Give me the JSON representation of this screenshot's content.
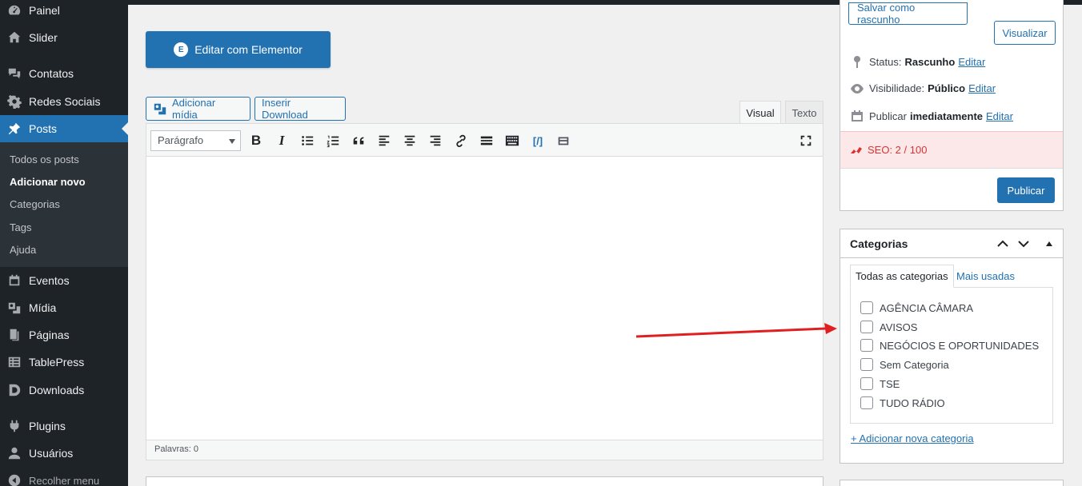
{
  "sidebar": {
    "items": [
      {
        "label": "Painel",
        "icon": "dashboard-icon"
      },
      {
        "label": "Slider",
        "icon": "home-icon"
      },
      {
        "label": "Contatos",
        "icon": "comments-icon"
      },
      {
        "label": "Redes Sociais",
        "icon": "gear-icon"
      },
      {
        "label": "Posts",
        "icon": "pin-icon"
      },
      {
        "label": "Eventos",
        "icon": "calendar-icon"
      },
      {
        "label": "Mídia",
        "icon": "media-icon"
      },
      {
        "label": "Páginas",
        "icon": "pages-icon"
      },
      {
        "label": "TablePress",
        "icon": "table-icon"
      },
      {
        "label": "Downloads",
        "icon": "download-d-icon"
      },
      {
        "label": "Plugins",
        "icon": "plugin-icon"
      },
      {
        "label": "Usuários",
        "icon": "user-icon"
      },
      {
        "label": "Recolher menu",
        "icon": "collapse-icon"
      }
    ],
    "submenu": [
      "Todos os posts",
      "Adicionar novo",
      "Categorias",
      "Tags",
      "Ajuda"
    ]
  },
  "editor": {
    "elementor_label": "Editar com Elementor",
    "add_media_label": "Adicionar mídia",
    "insert_download_label": "Inserir Download",
    "tabs": [
      "Visual",
      "Texto"
    ],
    "format_select": "Parágrafo",
    "word_count": "Palavras: 0"
  },
  "publish": {
    "save_draft": "Salvar como rascunho",
    "preview": "Visualizar",
    "status_label": "Status:",
    "status_value": "Rascunho",
    "visibility_label": "Visibilidade:",
    "visibility_value": "Público",
    "publish_label": "Publicar",
    "publish_value": "imediatamente",
    "edit": "Editar",
    "seo": "SEO: 2 / 100",
    "publish_button": "Publicar"
  },
  "categories": {
    "title": "Categorias",
    "tab_all": "Todas as categorias",
    "tab_most_used": "Mais usadas",
    "items": [
      "AGÊNCIA CÂMARA",
      "AVISOS",
      "NEGÓCIOS E OPORTUNIDADES",
      "Sem Categoria",
      "TSE",
      "TUDO RÁDIO"
    ],
    "add_new": "+ Adicionar nova categoria"
  },
  "colors": {
    "accent": "#2271b1",
    "sidebar": "#1d2327",
    "seo_error": "#dc3232",
    "annotation_arrow": "#e02020"
  }
}
